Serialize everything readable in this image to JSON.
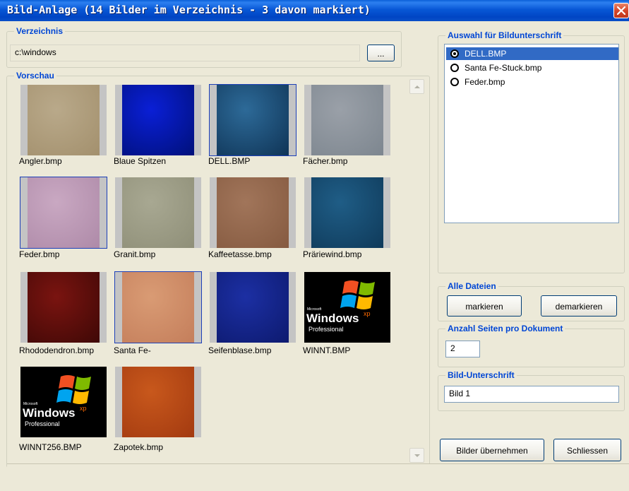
{
  "window": {
    "title": "Bild-Anlage (14 Bilder im Verzeichnis - 3 davon markiert)"
  },
  "verzeichnis": {
    "legend": "Verzeichnis",
    "path": "c:\\windows",
    "browse_label": "..."
  },
  "vorschau": {
    "legend": "Vorschau",
    "images": [
      {
        "name": "Angler.bmp",
        "selected": false,
        "colors": [
          "#b9a98a",
          "#a3906d"
        ]
      },
      {
        "name": "Blaue Spitzen",
        "selected": false,
        "colors": [
          "#0a1fd6",
          "#00107a"
        ]
      },
      {
        "name": "DELL.BMP",
        "selected": true,
        "colors": [
          "#2d6a98",
          "#0f3456"
        ]
      },
      {
        "name": "Fächer.bmp",
        "selected": false,
        "colors": [
          "#9aa0a8",
          "#7d868f"
        ]
      },
      {
        "name": "Feder.bmp",
        "selected": true,
        "colors": [
          "#c9a8c2",
          "#ae8aa8"
        ]
      },
      {
        "name": "Granit.bmp",
        "selected": false,
        "colors": [
          "#a8a892",
          "#8f8f78"
        ]
      },
      {
        "name": "Kaffeetasse.bmp",
        "selected": false,
        "colors": [
          "#a1755a",
          "#855a40"
        ]
      },
      {
        "name": "Präriewind.bmp",
        "selected": false,
        "colors": [
          "#1f5d86",
          "#0f3a5a"
        ]
      },
      {
        "name": "Rhododendron.bmp",
        "selected": false,
        "colors": [
          "#7a1410",
          "#3f0806"
        ]
      },
      {
        "name": "Santa Fe-",
        "selected": true,
        "colors": [
          "#d99b74",
          "#c47e5b"
        ]
      },
      {
        "name": "Seifenblase.bmp",
        "selected": false,
        "colors": [
          "#1c2fa3",
          "#0d1a6f"
        ]
      },
      {
        "name": "WINNT.BMP",
        "selected": false,
        "colors": [
          "#000000",
          "#000000"
        ],
        "logo": true
      },
      {
        "name": "WINNT256.BMP",
        "selected": false,
        "colors": [
          "#000000",
          "#000000"
        ],
        "logo": true
      },
      {
        "name": "Zapotek.bmp",
        "selected": false,
        "colors": [
          "#c8581c",
          "#a33a10"
        ]
      }
    ],
    "logo_text": {
      "small": "Microsoft",
      "main": "Windows",
      "sup": "xp",
      "edition": "Professional"
    }
  },
  "auswahl": {
    "legend": "Auswahl für Bildunterschrift",
    "items": [
      {
        "label": "DELL.BMP",
        "selected": true
      },
      {
        "label": "Santa Fe-Stuck.bmp",
        "selected": false
      },
      {
        "label": "Feder.bmp",
        "selected": false
      }
    ]
  },
  "alle_dateien": {
    "legend": "Alle Dateien",
    "markieren_label": "markieren",
    "demarkieren_label": "demarkieren"
  },
  "anzahl": {
    "legend": "Anzahl Seiten pro Dokument",
    "value": "2"
  },
  "unterschrift": {
    "legend": "Bild-Unterschrift",
    "value": "Bild 1"
  },
  "buttons": {
    "uebernehmen_label": "Bilder übernehmen",
    "schliessen_label": "Schliessen"
  }
}
